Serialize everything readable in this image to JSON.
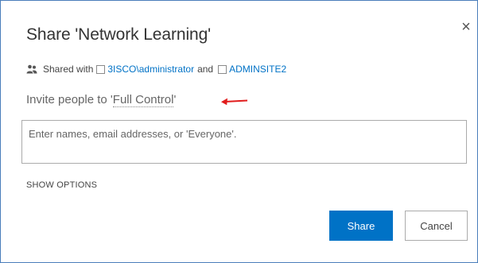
{
  "dialog": {
    "title": "Share 'Network Learning'",
    "close_icon": "×"
  },
  "shared_with": {
    "prefix": "Shared with",
    "user1": "3ISCO\\administrator",
    "conjunction": "and",
    "user2": "ADMINSITE2"
  },
  "invite": {
    "prefix": "Invite people to '",
    "permission": "Full Control",
    "suffix": "'"
  },
  "people_input": {
    "placeholder": "Enter names, email addresses, or 'Everyone'."
  },
  "show_options_label": "SHOW OPTIONS",
  "buttons": {
    "share_label": "Share",
    "cancel_label": "Cancel"
  },
  "colors": {
    "accent": "#0072c6",
    "annotation_arrow": "#e11d1d",
    "dialog_border": "#4a7ebb"
  },
  "icons": {
    "people": "people-icon",
    "close": "close-icon",
    "annotation": "red-arrow-icon"
  }
}
